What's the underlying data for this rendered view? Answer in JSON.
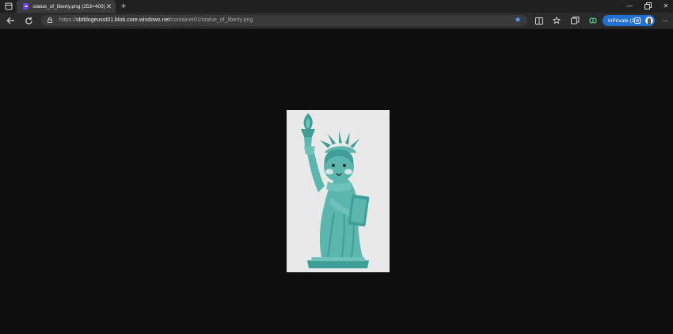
{
  "tab": {
    "title": "statue_of_liberty.png (253×400)"
  },
  "address_bar": {
    "protocol": "https://",
    "host": "sbtblogeusst01.blob.core.windows.net",
    "path": "/container01/statue_of_liberty.png"
  },
  "profile": {
    "label": "InPrivate (2"
  },
  "image": {
    "alt": "statue_of_liberty.png"
  },
  "icons": {
    "tab_actions": "tab-actions-icon",
    "new_tab": "plus-icon",
    "back": "back-arrow-icon",
    "refresh": "refresh-icon",
    "lock": "lock-icon",
    "favorite": "star-icon",
    "split": "split-screen-icon",
    "favorites": "favorites-icon",
    "collections": "collections-icon",
    "copilot": "copilot-icon",
    "more": "more-icon"
  },
  "colors": {
    "accent": "#1f72d1",
    "favorite": "#4aa6ff",
    "page_background": "#0e0e0e"
  }
}
